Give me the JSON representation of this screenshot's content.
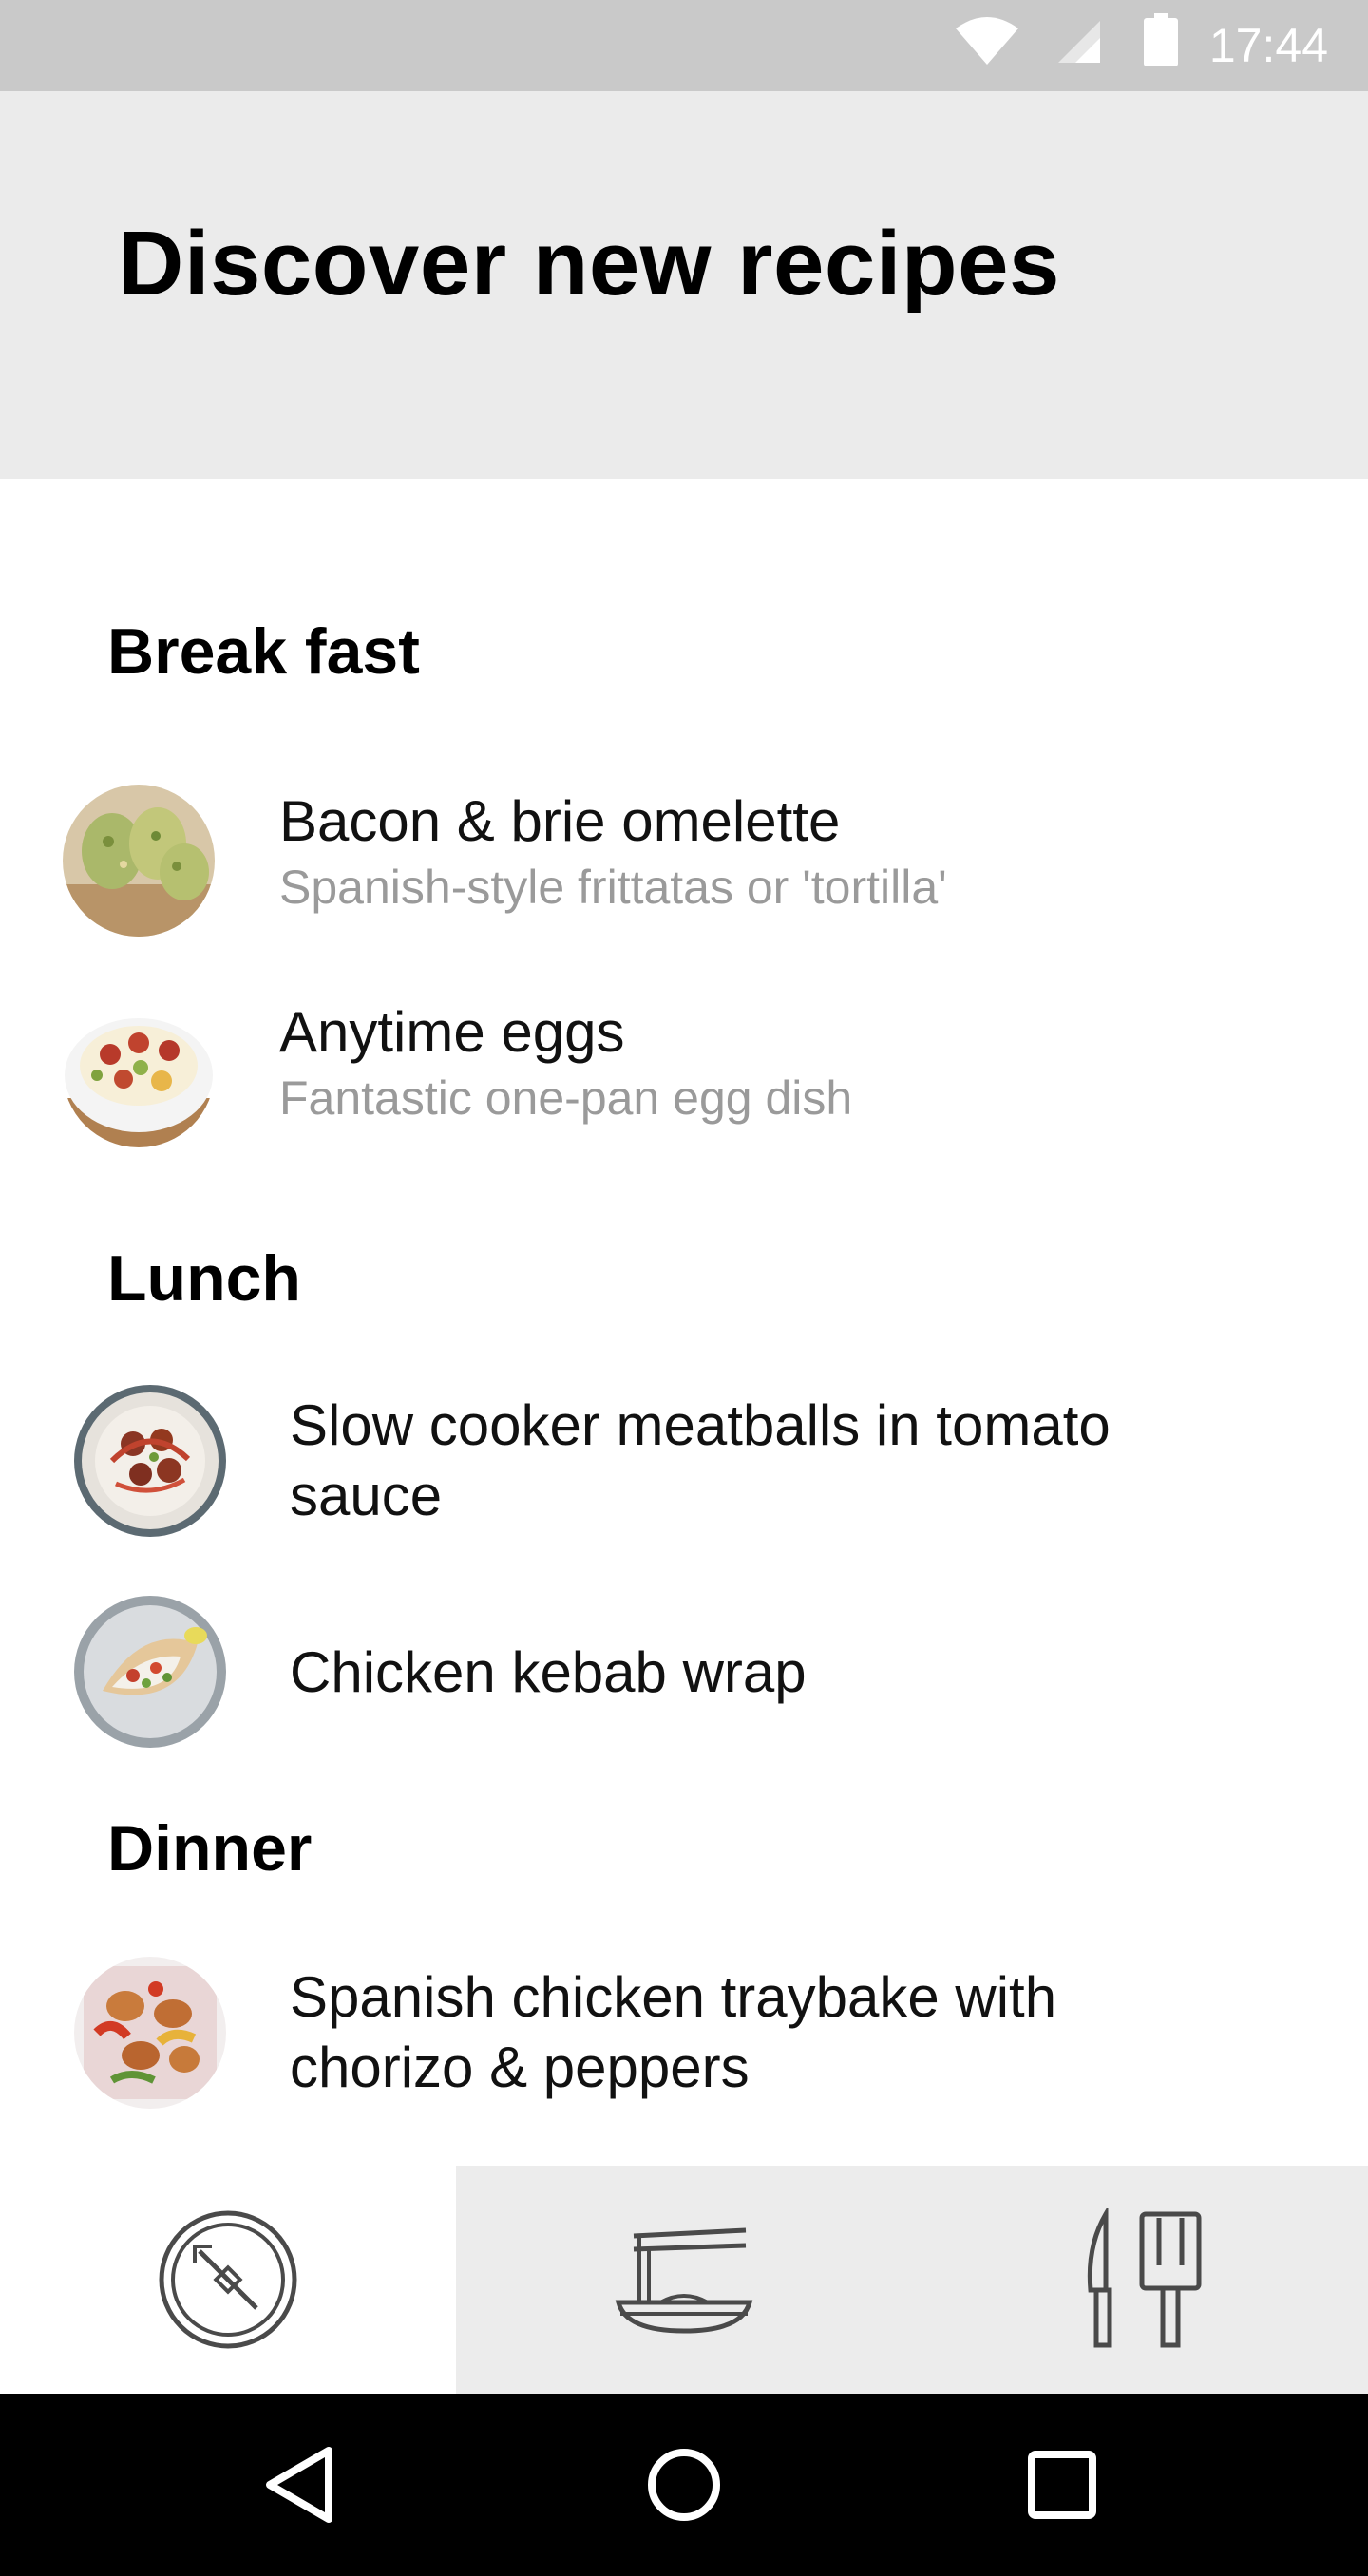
{
  "status_bar": {
    "time": "17:44",
    "icons": [
      "wifi-icon",
      "cellular-signal-icon",
      "battery-icon"
    ]
  },
  "header": {
    "title": "Discover new recipes"
  },
  "sections": [
    {
      "title": "Break fast",
      "items": [
        {
          "name": "Bacon & brie omelette",
          "subtitle": "Spanish-style frittatas or 'tortilla'"
        },
        {
          "name": "Anytime eggs",
          "subtitle": "Fantastic one-pan egg dish"
        }
      ]
    },
    {
      "title": "Lunch",
      "items": [
        {
          "name": "Slow cooker meatballs in tomato sauce"
        },
        {
          "name": "Chicken kebab wrap"
        }
      ]
    },
    {
      "title": "Dinner",
      "items": [
        {
          "name": "Spanish chicken traybake with chorizo & peppers"
        }
      ]
    }
  ],
  "bottom_nav": {
    "tabs": [
      {
        "icon": "compass-icon",
        "active": true
      },
      {
        "icon": "noodle-bowl-icon",
        "active": false
      },
      {
        "icon": "knife-spatula-icon",
        "active": false
      }
    ]
  },
  "system_nav": [
    "back-icon",
    "home-icon",
    "recents-icon"
  ],
  "colors": {
    "status_bar": "#c9c9c9",
    "header": "#ebebeb",
    "bottom_nav": "#ececec",
    "subtitle_text": "#9a9a9a"
  }
}
